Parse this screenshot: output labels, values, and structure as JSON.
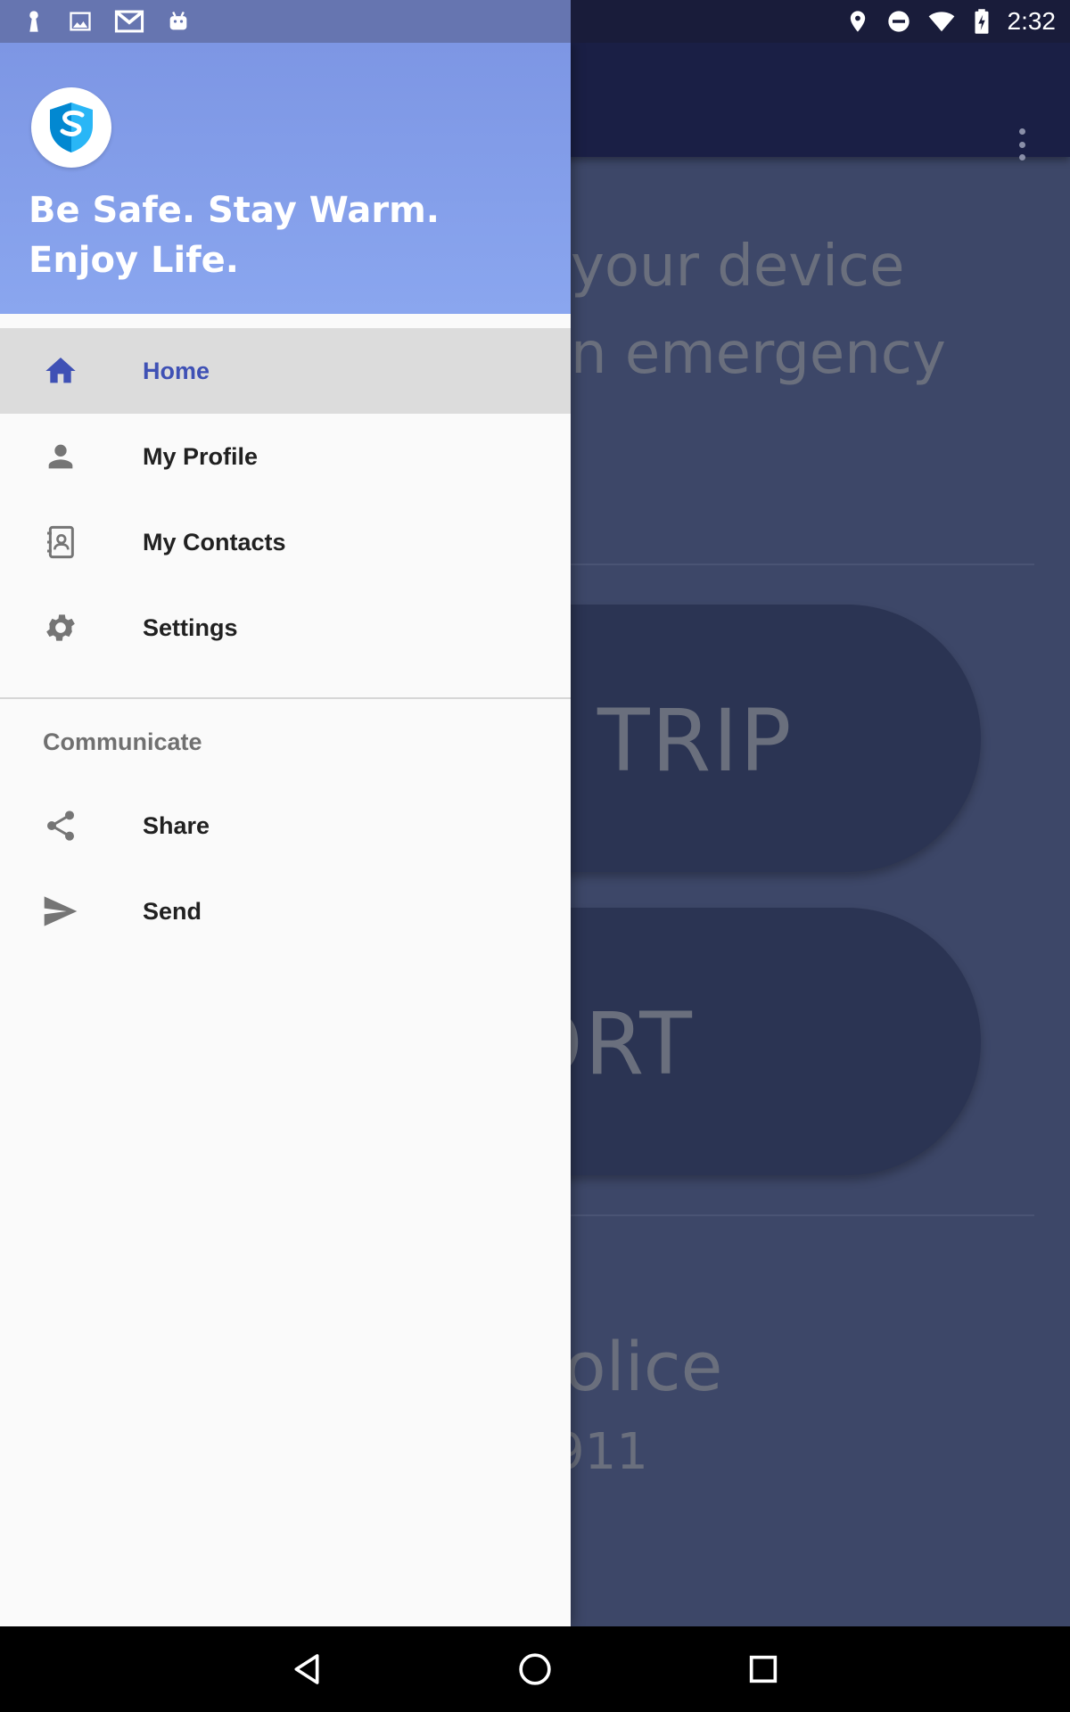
{
  "status_bar": {
    "time": "2:32",
    "left_icons": [
      "keyhole-icon",
      "image-icon",
      "gmail-icon",
      "android-icon"
    ],
    "right_icons": [
      "location-icon",
      "do-not-disturb-icon",
      "wifi-icon",
      "battery-charging-icon"
    ]
  },
  "drawer": {
    "header": {
      "logo_icon": "shield-logo-icon",
      "tagline": "Be Safe. Stay Warm. Enjoy Life.",
      "background_color": "#8aa6ef"
    },
    "items": [
      {
        "label": "Home",
        "icon": "home-icon",
        "active": true
      },
      {
        "label": "My Profile",
        "icon": "person-icon",
        "active": false
      },
      {
        "label": "My Contacts",
        "icon": "contacts-icon",
        "active": false
      },
      {
        "label": "Settings",
        "icon": "gear-icon",
        "active": false
      }
    ],
    "section_title": "Communicate",
    "communicate_items": [
      {
        "label": "Share",
        "icon": "share-icon"
      },
      {
        "label": "Send",
        "icon": "send-icon"
      }
    ],
    "accent_color": "#3f51b5"
  },
  "background_screen": {
    "message_line1": "your device",
    "message_line2": "n emergency",
    "message_line3": "!",
    "button1": "TRIP",
    "button2": "ORT",
    "police_label": "Police",
    "police_number": "911",
    "overflow_icon": "more-vert-icon"
  },
  "nav_bar": {
    "icons": [
      "back-icon",
      "home-circle-icon",
      "recents-icon"
    ]
  }
}
